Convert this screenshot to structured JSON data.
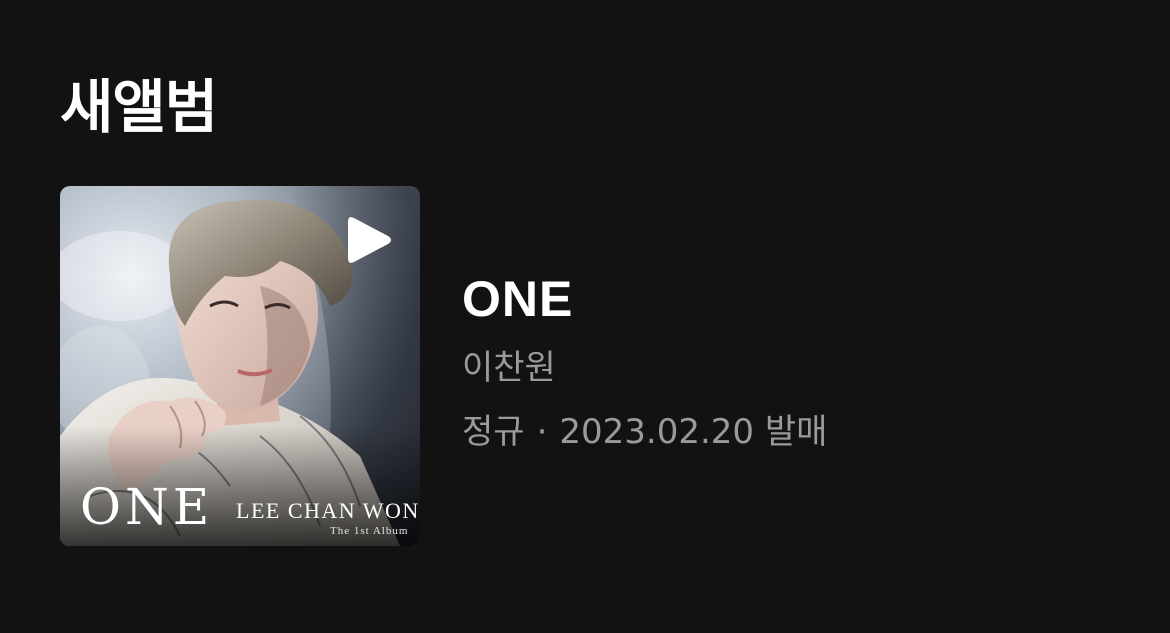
{
  "section": {
    "title": "새앨범"
  },
  "album": {
    "title": "ONE",
    "artist": "이찬원",
    "type": "정규",
    "separator": "·",
    "release": "2023.02.20 발매",
    "cover": {
      "title": "ONE",
      "artist": "LEE CHAN WON",
      "subtitle": "The 1st Album"
    }
  },
  "icons": {
    "play": "play-icon"
  },
  "colors": {
    "background": "#121212",
    "title_text": "#ffffff",
    "secondary_text": "#9a9a9a"
  }
}
